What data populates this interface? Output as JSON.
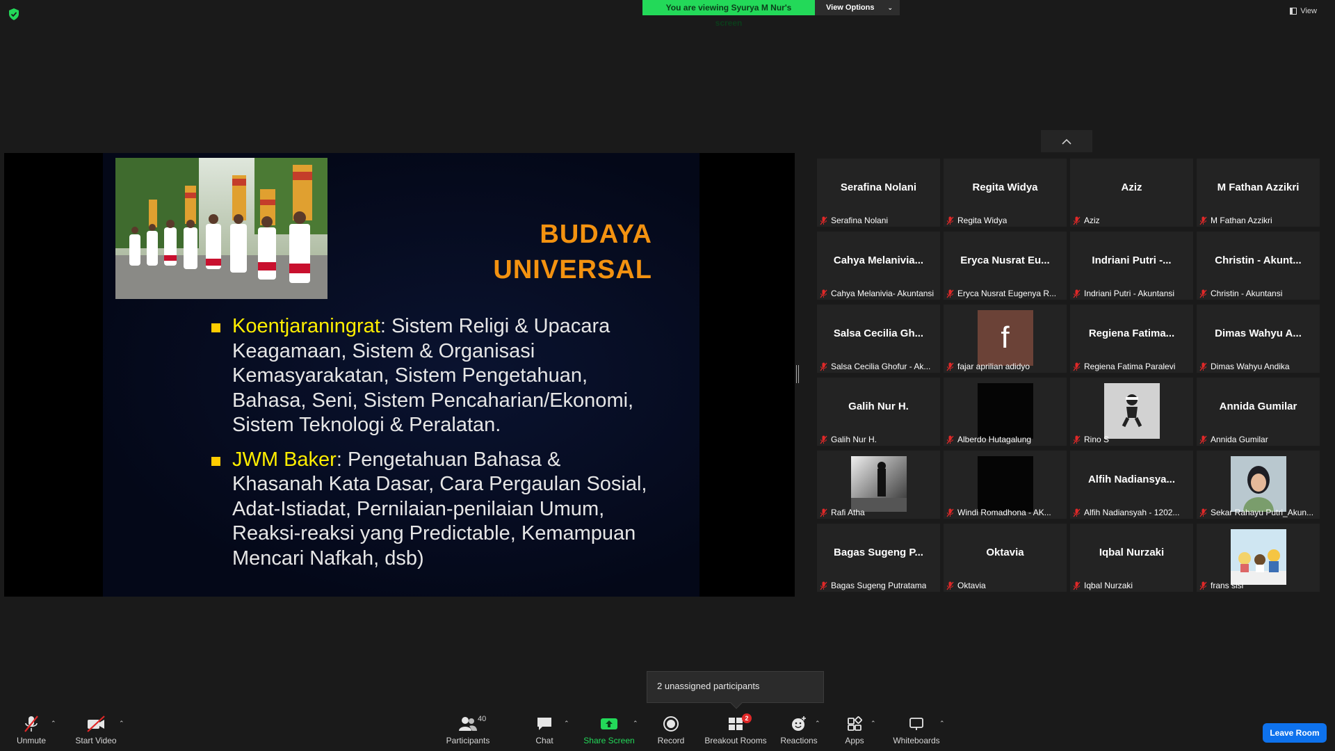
{
  "share_banner": {
    "message": "You are viewing Syurya M Nur's screen",
    "options_label": "View Options"
  },
  "view_button": {
    "label": "View"
  },
  "slide": {
    "title_line1": "BUDAYA",
    "title_line2": "UNIVERSAL",
    "bullets": [
      {
        "keyword": "Koentjaraningrat",
        "text": ": Sistem Religi & Upacara Keagamaan, Sistem & Organisasi Kemasyarakatan, Sistem Pengetahuan, Bahasa, Seni, Sistem Pencaharian/Ekonomi, Sistem Teknologi & Peralatan."
      },
      {
        "keyword": "JWM Baker",
        "text": ": Pengetahuan Bahasa & Khasanah Kata Dasar, Cara Pergaulan Sosial, Adat-Istiadat, Pernilaian-penilaian Umum, Reaksi-reaksi yang Predictable, Kemampuan Mencari Nafkah, dsb)"
      }
    ]
  },
  "participants": [
    {
      "big": "Serafina Nolani",
      "label": "Serafina Nolani",
      "kind": "name"
    },
    {
      "big": "Regita Widya",
      "label": "Regita Widya",
      "kind": "name"
    },
    {
      "big": "Aziz",
      "label": "Aziz",
      "kind": "name"
    },
    {
      "big": "M Fathan Azzikri",
      "label": "M Fathan Azzikri",
      "kind": "name"
    },
    {
      "big": "Cahya  Melanivia...",
      "label": "Cahya Melanivia- Akuntansi",
      "kind": "name"
    },
    {
      "big": "Eryca Nusrat Eu...",
      "label": "Eryca Nusrat Eugenya R...",
      "kind": "name"
    },
    {
      "big": "Indriani Putri -...",
      "label": "Indriani Putri - Akuntansi",
      "kind": "name"
    },
    {
      "big": "Christin  - Akunt...",
      "label": "Christin  - Akuntansi",
      "kind": "name"
    },
    {
      "big": "Salsa  Cecilia  Gh...",
      "label": "Salsa Cecilia Ghofur - Ak...",
      "kind": "name"
    },
    {
      "big": "",
      "label": "fajar aprilian adidyo",
      "kind": "fb"
    },
    {
      "big": "Regiena  Fatima...",
      "label": "Regiena Fatima Paralevi",
      "kind": "name"
    },
    {
      "big": "Dimas  Wahyu  A...",
      "label": "Dimas Wahyu Andika",
      "kind": "name"
    },
    {
      "big": "Galih Nur H.",
      "label": "Galih Nur H.",
      "kind": "name"
    },
    {
      "big": "",
      "label": "Alberdo Hutagalung",
      "kind": "black"
    },
    {
      "big": "",
      "label": "Rino S",
      "kind": "figure"
    },
    {
      "big": "Annida Gumilar",
      "label": "Annida Gumilar",
      "kind": "name"
    },
    {
      "big": "",
      "label": "Rafi Atha",
      "kind": "bw"
    },
    {
      "big": "",
      "label": "Windi Romadhona - AK...",
      "kind": "black"
    },
    {
      "big": "Alfih  Nadiansya...",
      "label": "Alfih Nadiansyah - 1202...",
      "kind": "name"
    },
    {
      "big": "",
      "label": "Sekar Rahayu Putri_Akun...",
      "kind": "photo"
    },
    {
      "big": "Bagas  Sugeng  P...",
      "label": "Bagas Sugeng Putratama",
      "kind": "name"
    },
    {
      "big": "Oktavia",
      "label": "Oktavia",
      "kind": "name"
    },
    {
      "big": "Iqbal Nurzaki",
      "label": "Iqbal Nurzaki",
      "kind": "name"
    },
    {
      "big": "",
      "label": "frans sisi",
      "kind": "toys"
    }
  ],
  "fb_letter": "f",
  "popup": {
    "text": "2 unassigned participants"
  },
  "toolbar": {
    "unmute": "Unmute",
    "start_video": "Start Video",
    "participants": "Participants",
    "participants_count": "40",
    "chat": "Chat",
    "share_screen": "Share Screen",
    "record": "Record",
    "breakout_rooms": "Breakout Rooms",
    "breakout_badge": "2",
    "reactions": "Reactions",
    "apps": "Apps",
    "whiteboards": "Whiteboards",
    "leave": "Leave Room"
  },
  "colors": {
    "share_green": "#23d959",
    "leave_blue": "#0e72ed",
    "title_orange": "#f39210",
    "keyword_yellow": "#ffee00"
  }
}
